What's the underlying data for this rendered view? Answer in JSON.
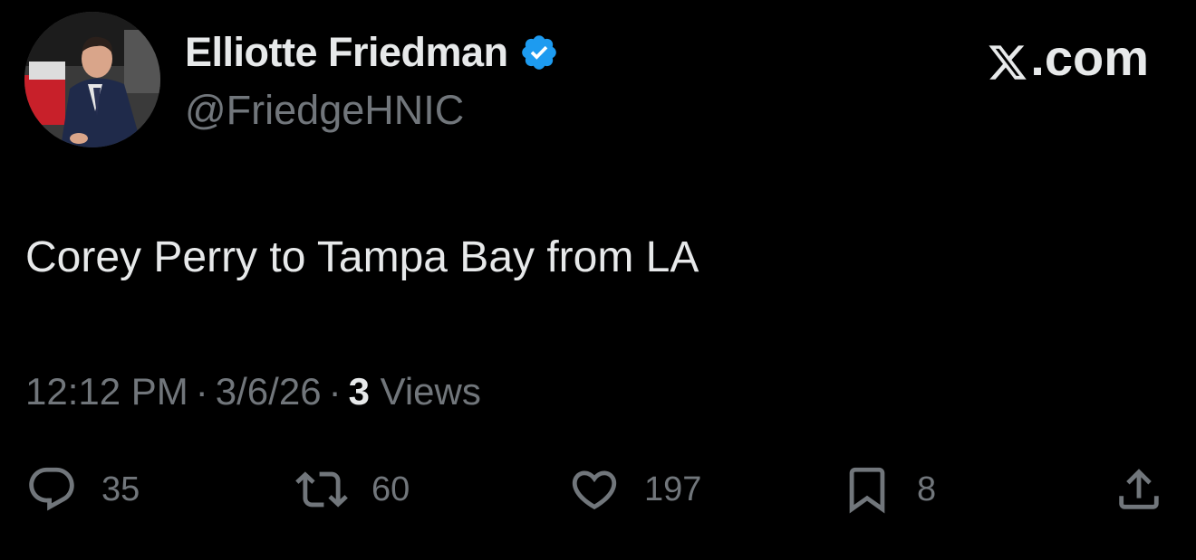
{
  "author": {
    "display_name": "Elliotte Friedman",
    "handle": "@FriedgeHNIC",
    "verified": true,
    "avatar_icon": "person-in-suit-avatar"
  },
  "brand": {
    "label": ".com",
    "icon": "x-logo-icon"
  },
  "tweet": {
    "text": "Corey Perry to Tampa Bay from LA"
  },
  "meta": {
    "time": "12:12 PM",
    "separator": "·",
    "date": "3/6/26",
    "views_count": "3",
    "views_label": "Views"
  },
  "actions": {
    "reply": {
      "icon": "reply-icon",
      "count": "35"
    },
    "repost": {
      "icon": "repost-icon",
      "count": "60"
    },
    "like": {
      "icon": "heart-icon",
      "count": "197"
    },
    "bookmark": {
      "icon": "bookmark-icon",
      "count": "8"
    },
    "share": {
      "icon": "share-icon"
    }
  },
  "colors": {
    "background": "#000000",
    "primary_text": "#e7e9ea",
    "secondary_text": "#71767b",
    "verified_blue": "#1d9bf0"
  }
}
